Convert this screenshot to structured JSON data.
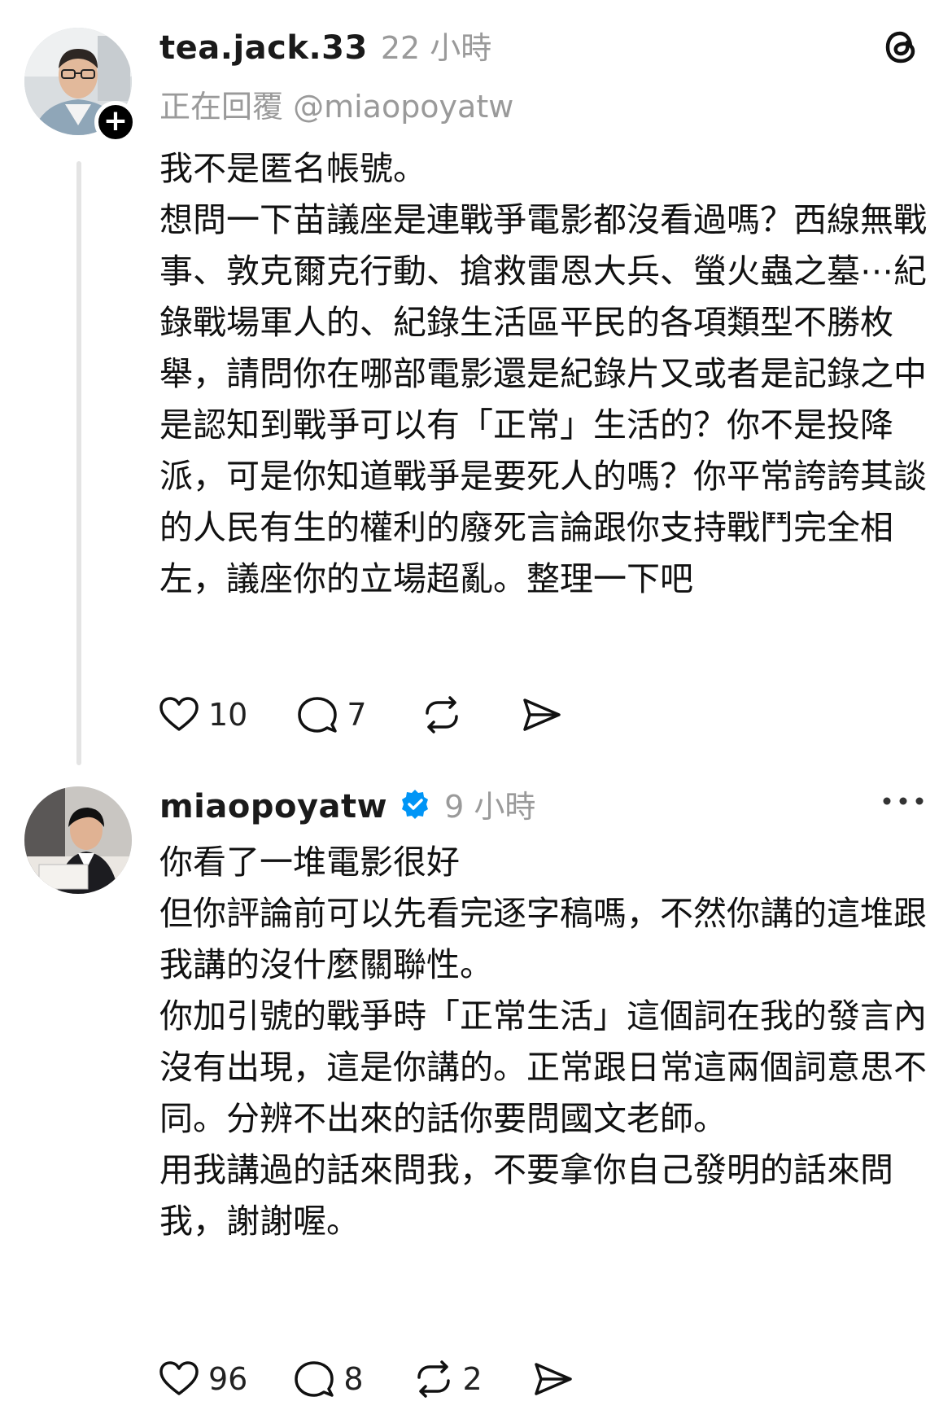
{
  "posts": [
    {
      "username": "tea.jack.33",
      "time": "22 小時",
      "reply_to": "正在回覆 @miaopoyatw",
      "paragraphs": [
        "我不是匿名帳號。",
        "想問一下苗議座是連戰爭電影都沒看過嗎？西線無戰事、敦克爾克行動、搶救雷恩大兵、螢火蟲之墓⋯紀錄戰場軍人的、紀錄生活區平民的各項類型不勝枚舉，請問你在哪部電影還是紀錄片又或者是記錄之中是認知到戰爭可以有「正常」生活的？你不是投降派，可是你知道戰爭是要死人的嗎？你平常誇誇其談的人民有生的權利的廢死言論跟你支持戰鬥完全相左，議座你的立場超亂。整理一下吧"
      ],
      "likes": "10",
      "replies": "7",
      "reposts": ""
    },
    {
      "username": "miaopoyatw",
      "time": "9 小時",
      "paragraphs": [
        "你看了一堆電影很好",
        "但你評論前可以先看完逐字稿嗎，不然你講的這堆跟我講的沒什麼關聯性。",
        "你加引號的戰爭時「正常生活」這個詞在我的發言內沒有出現，這是你講的。正常跟日常這兩個詞意思不同。分辨不出來的話你要問國文老師。",
        "用我講過的話來問我，不要拿你自己發明的話來問我，謝謝喔。"
      ],
      "likes": "96",
      "replies": "8",
      "reposts": "2"
    }
  ],
  "colors": {
    "text": "#111111",
    "muted": "#9a9a9a",
    "verified": "#0095f6",
    "thread_line": "#e4e4e4"
  },
  "icons": [
    "threads-logo-icon",
    "follow-plus-icon",
    "verified-badge-icon",
    "more-icon",
    "heart-icon",
    "comment-icon",
    "repost-icon",
    "share-icon"
  ]
}
